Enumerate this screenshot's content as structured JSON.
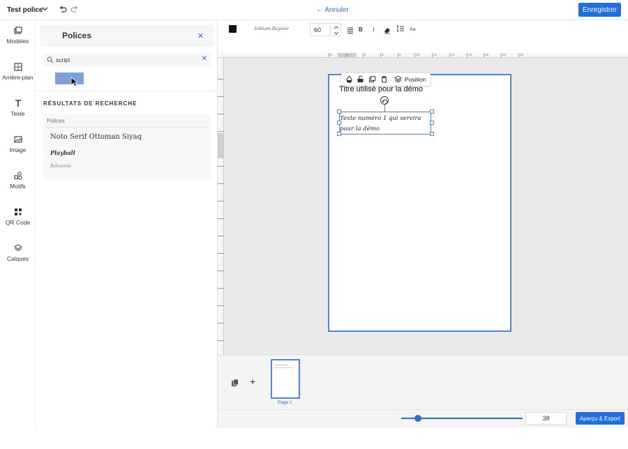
{
  "topbar": {
    "doc_title": "Test police",
    "cancel_label": "Annuler",
    "save_label": "Enregistrer"
  },
  "rail": {
    "items": [
      {
        "label": "Modèles",
        "icon": "templates-icon"
      },
      {
        "label": "Arrière-plan",
        "icon": "background-icon"
      },
      {
        "label": "Texte",
        "icon": "text-icon"
      },
      {
        "label": "Image",
        "icon": "image-icon"
      },
      {
        "label": "Motifs",
        "icon": "shapes-icon"
      },
      {
        "label": "QR Code",
        "icon": "qr-code-icon"
      },
      {
        "label": "Calques",
        "icon": "layers-icon"
      }
    ]
  },
  "fonts_panel": {
    "title": "Polices",
    "search_value": "script",
    "results_heading": "RÉSULTATS DE RECHERCHE",
    "section_label": "Polices",
    "fonts": [
      "Noto Serif Ottoman Siyaq",
      "Playball",
      "Babavoda"
    ]
  },
  "format_toolbar": {
    "text_color": "#111111",
    "font_name": "Arkham Regular",
    "font_size": "60",
    "bold_label": "B",
    "italic_label": "I",
    "case_label": "Aa"
  },
  "ruler": {
    "top_ticks": [
      "0",
      "2",
      "4",
      "6",
      "8",
      "10",
      "12",
      "14",
      "16",
      "18",
      "20",
      "22"
    ]
  },
  "canvas": {
    "title_text": "Titre utilisé pour la démo",
    "selected_text": "Texte numéro 1 qui servira pour la démo",
    "element_toolbar": {
      "position_label": "Position"
    }
  },
  "pages": {
    "thumb_label": "Page 1"
  },
  "bottombar": {
    "zoom_value": "38",
    "zoom_fraction": 0.14,
    "export_label": "Aperçu & Export"
  },
  "colors": {
    "accent": "#1f6fe0",
    "selection": "#4c86d9"
  }
}
